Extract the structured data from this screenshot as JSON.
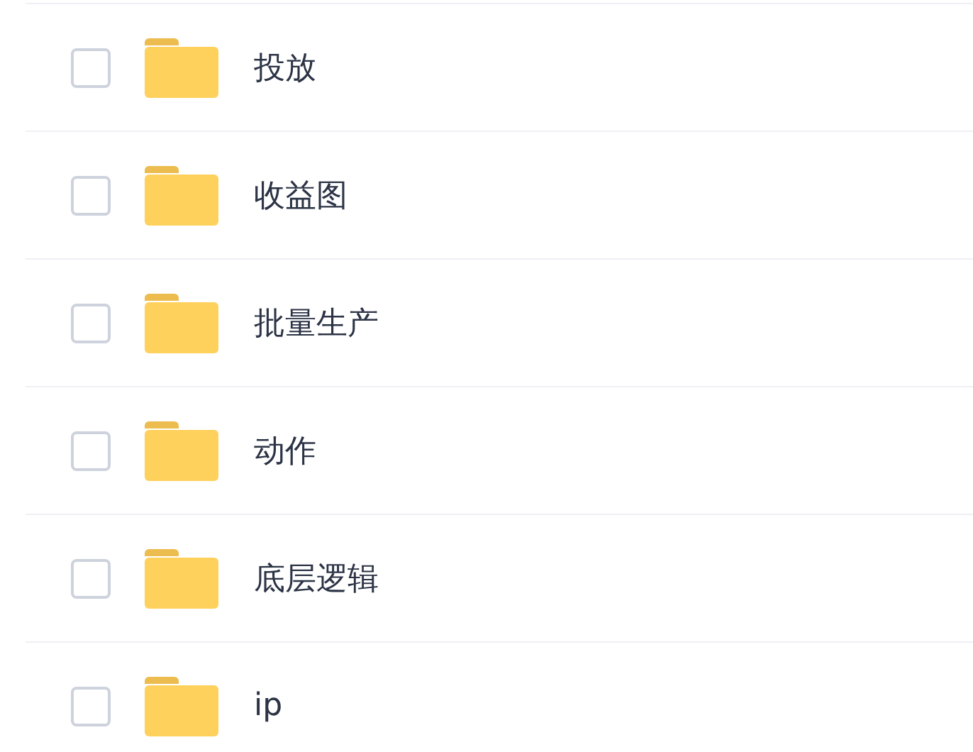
{
  "files": [
    {
      "name": "投放",
      "checked": false
    },
    {
      "name": "收益图",
      "checked": false
    },
    {
      "name": "批量生产",
      "checked": false
    },
    {
      "name": "动作",
      "checked": false
    },
    {
      "name": "底层逻辑",
      "checked": false
    },
    {
      "name": "ip",
      "checked": false
    }
  ]
}
